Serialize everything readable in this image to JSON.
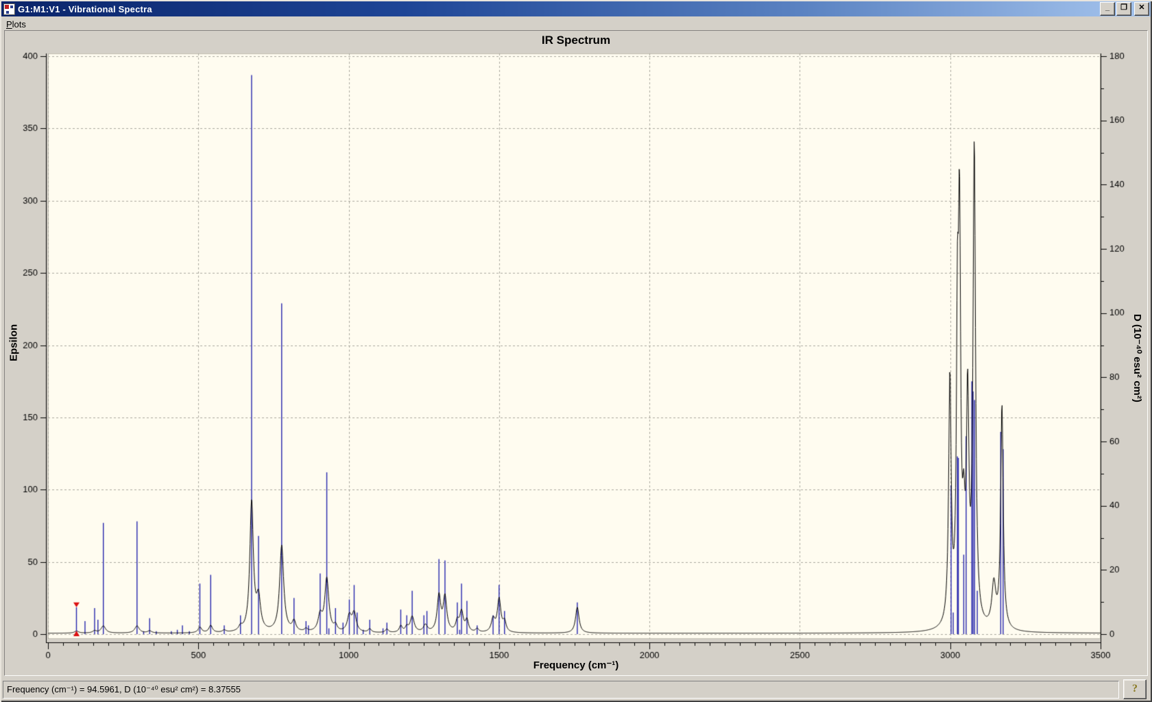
{
  "window": {
    "title": "G1:M1:V1 - Vibrational Spectra",
    "controls": {
      "minimize": "_",
      "restore": "❐",
      "close": "✕"
    }
  },
  "menu": {
    "items": [
      {
        "label": "Plots",
        "accel": "P",
        "rest": "lots"
      }
    ]
  },
  "status_bar": {
    "message": "Frequency (cm⁻¹) = 94.5961, D (10⁻⁴⁰ esu² cm²) = 8.37555",
    "help_label": "?"
  },
  "chart_data": {
    "type": "line",
    "title": "IR Spectrum",
    "xlabel": "Frequency (cm⁻¹)",
    "ylabel_left": "Epsilon",
    "ylabel_right": "D (10⁻⁴⁰ esu² cm²)",
    "xlim": [
      0,
      3500
    ],
    "ylim_left": [
      0,
      400
    ],
    "ylim_right": [
      0,
      180
    ],
    "x_major_ticks": [
      0,
      500,
      1000,
      1500,
      2000,
      2500,
      3000,
      3500
    ],
    "x_minor_step": 50,
    "y_left_major_ticks": [
      0,
      50,
      100,
      150,
      200,
      250,
      300,
      350,
      400
    ],
    "y_right_major_ticks": [
      0,
      20,
      40,
      60,
      80,
      100,
      120,
      140,
      160,
      180
    ],
    "y_right_minor_step": 10,
    "grid": "dashed",
    "legend": "none",
    "colors": {
      "plot_bg": "#fffcf0",
      "panel_bg": "#d4d0c8",
      "grid": "#a9a79d",
      "axis": "#000000",
      "stick": "#2525ad",
      "envelope": "#000000",
      "marker": "#dd1010",
      "plot_border": "#c2bfb2"
    },
    "cursor_marker": {
      "frequency": 94.5961,
      "d_value": 8.37555,
      "epsilon_equiv": 18.6
    },
    "series": [
      {
        "name": "ir-sticks",
        "type": "stick",
        "units": "cm-1 vs Epsilon",
        "points": [
          [
            123,
            9
          ],
          [
            155,
            18
          ],
          [
            166,
            10
          ],
          [
            184,
            77
          ],
          [
            296,
            78
          ],
          [
            318,
            2
          ],
          [
            338,
            11
          ],
          [
            360,
            2
          ],
          [
            410,
            2
          ],
          [
            430,
            3
          ],
          [
            447,
            6
          ],
          [
            470,
            2
          ],
          [
            505,
            35
          ],
          [
            541,
            41
          ],
          [
            586,
            6
          ],
          [
            640,
            13
          ],
          [
            677,
            387
          ],
          [
            700,
            68
          ],
          [
            777,
            229
          ],
          [
            818,
            25
          ],
          [
            858,
            9
          ],
          [
            866,
            6
          ],
          [
            905,
            42
          ],
          [
            927,
            112
          ],
          [
            934,
            4
          ],
          [
            956,
            18
          ],
          [
            981,
            8
          ],
          [
            1002,
            24
          ],
          [
            1018,
            34
          ],
          [
            1028,
            15
          ],
          [
            1048,
            3
          ],
          [
            1070,
            10
          ],
          [
            1114,
            4
          ],
          [
            1127,
            8
          ],
          [
            1173,
            17
          ],
          [
            1193,
            13
          ],
          [
            1211,
            30
          ],
          [
            1250,
            13
          ],
          [
            1260,
            16
          ],
          [
            1300,
            52
          ],
          [
            1320,
            51
          ],
          [
            1361,
            22
          ],
          [
            1369,
            3
          ],
          [
            1375,
            35
          ],
          [
            1393,
            23
          ],
          [
            1427,
            6
          ],
          [
            1480,
            13
          ],
          [
            1500,
            34
          ],
          [
            1518,
            16
          ],
          [
            1760,
            22
          ],
          [
            3003,
            103
          ],
          [
            3010,
            15
          ],
          [
            3024,
            123
          ],
          [
            3027,
            122
          ],
          [
            3045,
            55
          ],
          [
            3053,
            137
          ],
          [
            3072,
            175
          ],
          [
            3076,
            168
          ],
          [
            3081,
            162
          ],
          [
            3090,
            30
          ],
          [
            3168,
            140
          ],
          [
            3176,
            128
          ]
        ]
      },
      {
        "name": "ir-envelope",
        "type": "lorentzian-sum",
        "baseline": 0.6,
        "sample_step": 1.5,
        "peaks": [
          [
            95,
            1.5,
            8
          ],
          [
            155,
            1.5,
            8
          ],
          [
            184,
            5,
            9
          ],
          [
            296,
            5,
            9
          ],
          [
            338,
            1.5,
            8
          ],
          [
            505,
            4,
            7
          ],
          [
            541,
            5,
            7
          ],
          [
            586,
            1.5,
            7
          ],
          [
            640,
            3,
            7
          ],
          [
            677,
            90,
            7
          ],
          [
            700,
            22,
            8
          ],
          [
            777,
            60,
            8
          ],
          [
            818,
            7,
            7
          ],
          [
            858,
            2,
            6
          ],
          [
            905,
            11,
            8
          ],
          [
            927,
            37,
            8
          ],
          [
            956,
            4,
            6
          ],
          [
            1002,
            11,
            8
          ],
          [
            1018,
            13,
            8
          ],
          [
            1070,
            2.5,
            6
          ],
          [
            1127,
            2.5,
            6
          ],
          [
            1173,
            4.5,
            6
          ],
          [
            1193,
            3.5,
            6
          ],
          [
            1211,
            11,
            8
          ],
          [
            1255,
            5,
            8
          ],
          [
            1300,
            25,
            7
          ],
          [
            1320,
            24,
            7
          ],
          [
            1361,
            7,
            6
          ],
          [
            1375,
            14,
            7
          ],
          [
            1393,
            8,
            6
          ],
          [
            1427,
            2.5,
            6
          ],
          [
            1480,
            9,
            7
          ],
          [
            1500,
            23,
            7
          ],
          [
            1518,
            7,
            6
          ],
          [
            1760,
            18,
            7
          ],
          [
            2999,
            170,
            5
          ],
          [
            3024,
            180,
            4
          ],
          [
            3031,
            260,
            4.5
          ],
          [
            3045,
            55,
            5
          ],
          [
            3058,
            150,
            5
          ],
          [
            3080,
            330,
            5
          ],
          [
            3145,
            30,
            8
          ],
          [
            3172,
            155,
            5
          ]
        ]
      }
    ]
  }
}
